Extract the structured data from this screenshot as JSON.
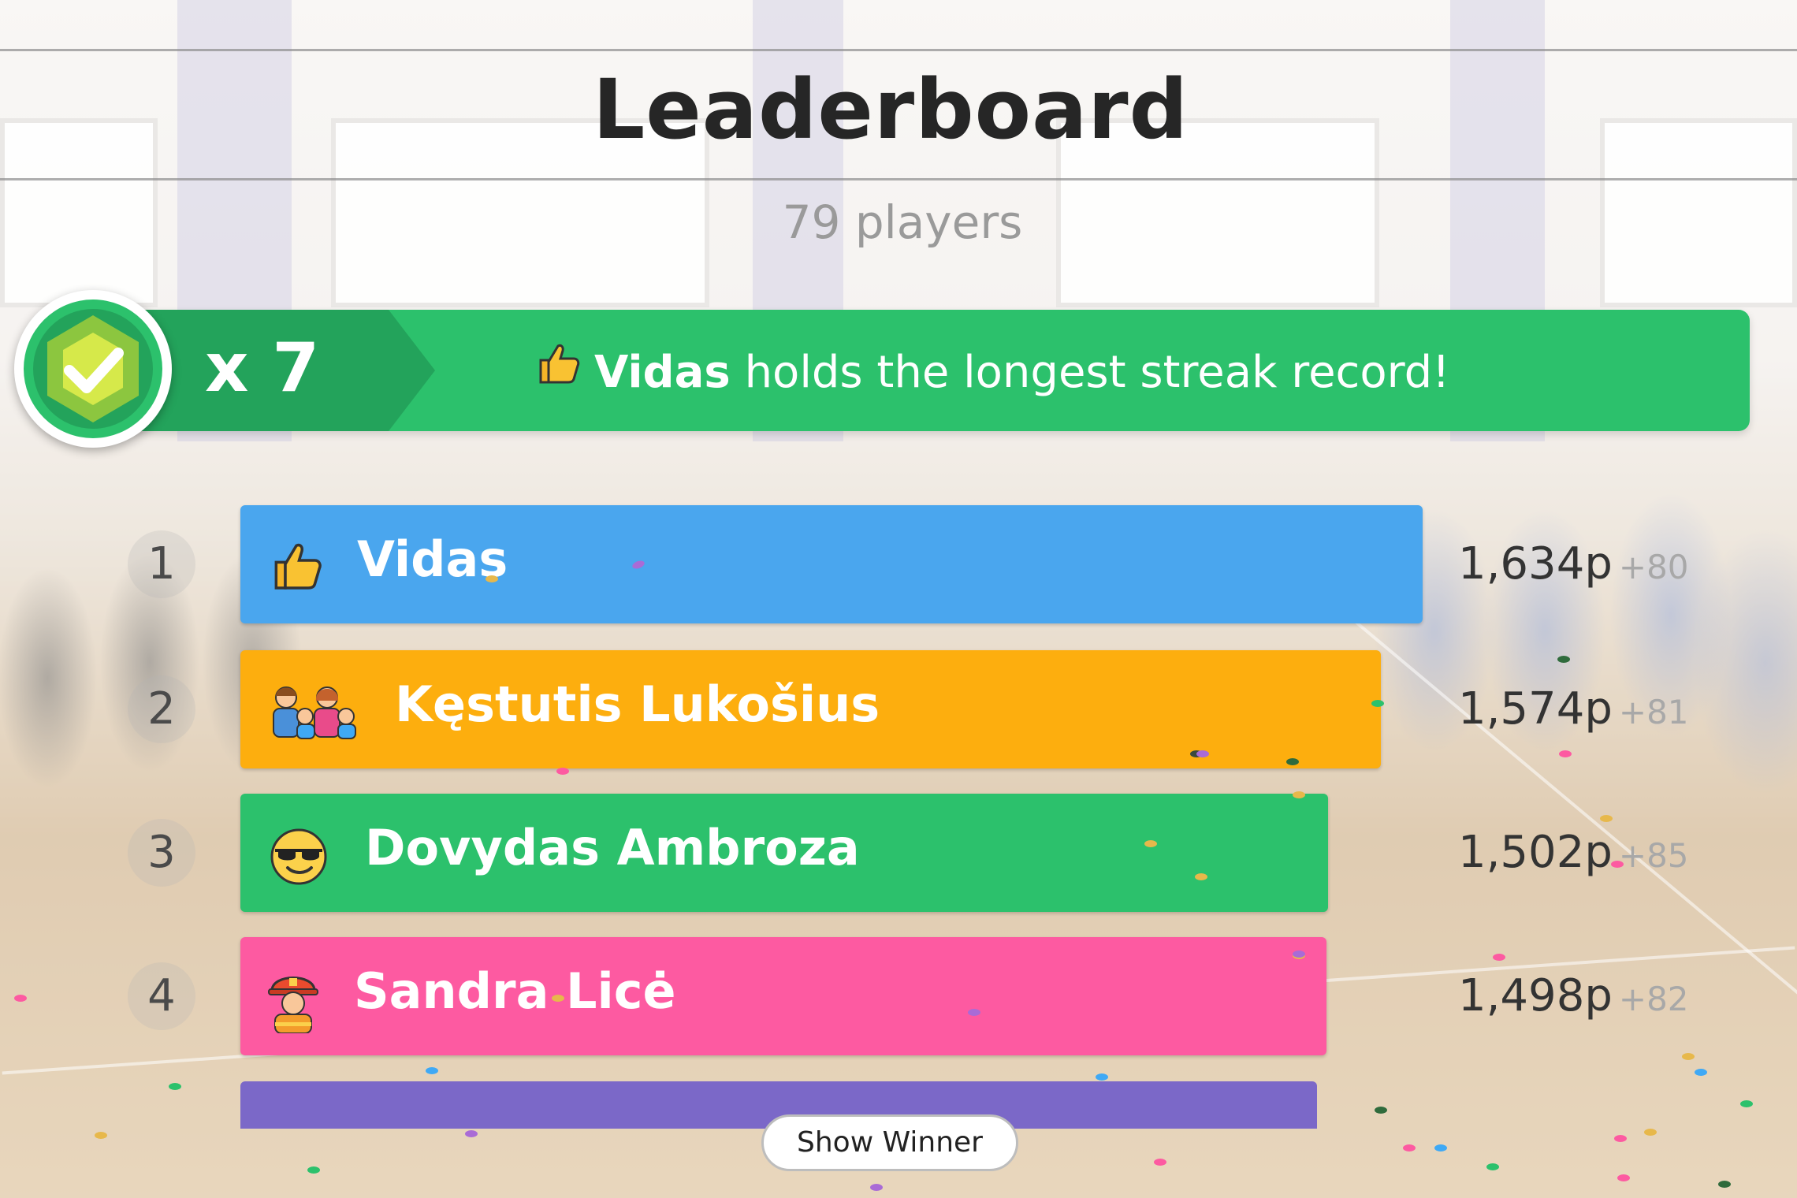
{
  "header": {
    "title": "Leaderboard",
    "players": "79 players"
  },
  "streak": {
    "multiplier": "x 7",
    "player": "Vidas",
    "message": " holds the longest streak record!",
    "icon": "thumbs-up-icon",
    "color": "#2cc16c"
  },
  "leaderboard": [
    {
      "rank": "1",
      "name": "Vidas",
      "icon": "thumbs-up-icon",
      "score": "1,634p",
      "delta": "+80",
      "color": "#4aa6ee"
    },
    {
      "rank": "2",
      "name": "Kęstutis Lukošius",
      "icon": "family-icon",
      "score": "1,574p",
      "delta": "+81",
      "color": "#fdae0e"
    },
    {
      "rank": "3",
      "name": "Dovydas Ambroza",
      "icon": "sunglasses-face-icon",
      "score": "1,502p",
      "delta": "+85",
      "color": "#2cc16c"
    },
    {
      "rank": "4",
      "name": "Sandra Licė",
      "icon": "firefighter-icon",
      "score": "1,498p",
      "delta": "+82",
      "color": "#fd5aa1"
    }
  ],
  "next_bar_color": "#7b68c8",
  "actions": {
    "show_winner": "Show Winner"
  }
}
